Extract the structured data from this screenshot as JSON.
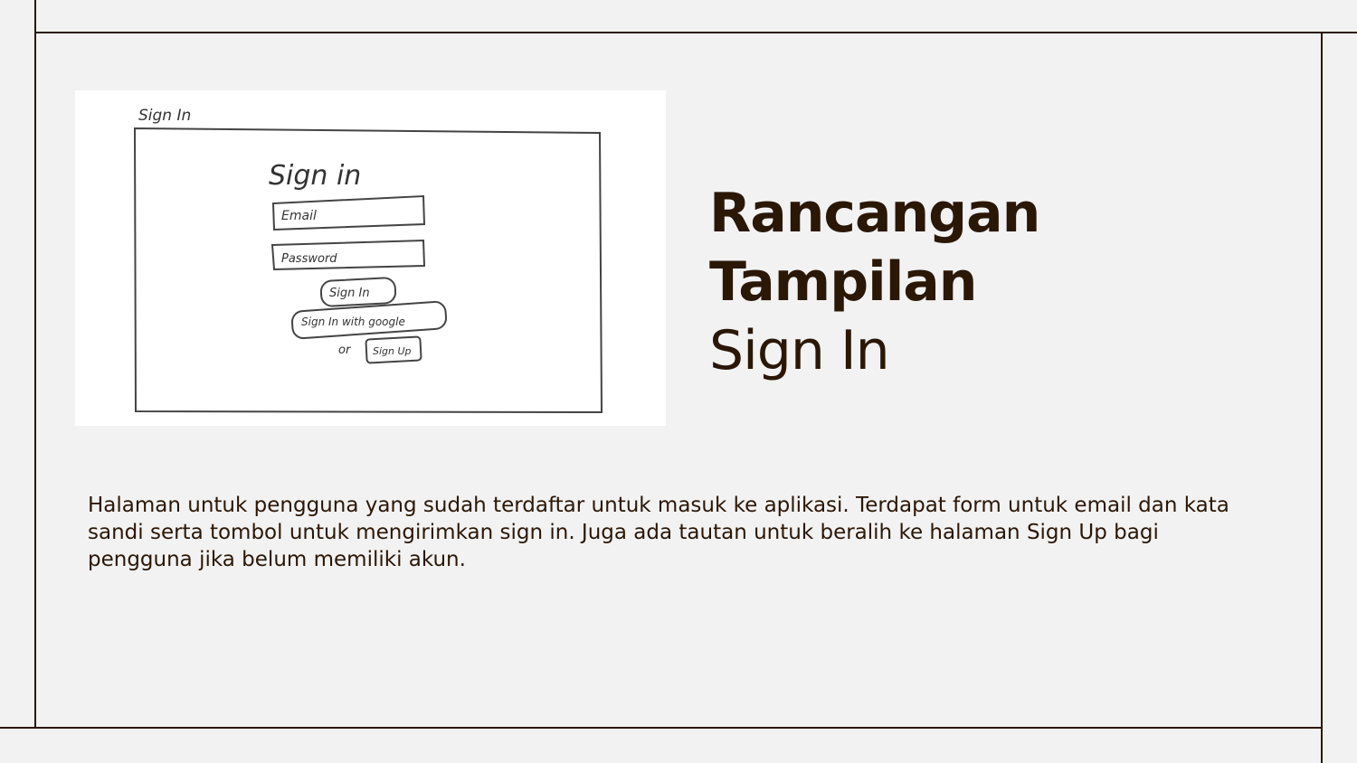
{
  "slide": {
    "title_line1": "Rancangan",
    "title_line2": "Tampilan",
    "subtitle": "Sign In",
    "description": "Halaman untuk pengguna yang sudah terdaftar untuk masuk ke aplikasi. Terdapat form untuk email dan kata sandi serta tombol untuk mengirimkan sign in. Juga ada tautan untuk beralih ke halaman Sign Up bagi pengguna jika belum memiliki akun."
  },
  "sketch": {
    "frame_label": "Sign In",
    "heading": "Sign in",
    "email_placeholder": "Email",
    "password_placeholder": "Password",
    "sign_in_button": "Sign In",
    "google_button": "Sign In with google",
    "or_text": "or",
    "sign_up_button": "Sign Up"
  },
  "colors": {
    "background": "#f2f2f2",
    "text": "#2b1706",
    "line": "#2b1706"
  }
}
